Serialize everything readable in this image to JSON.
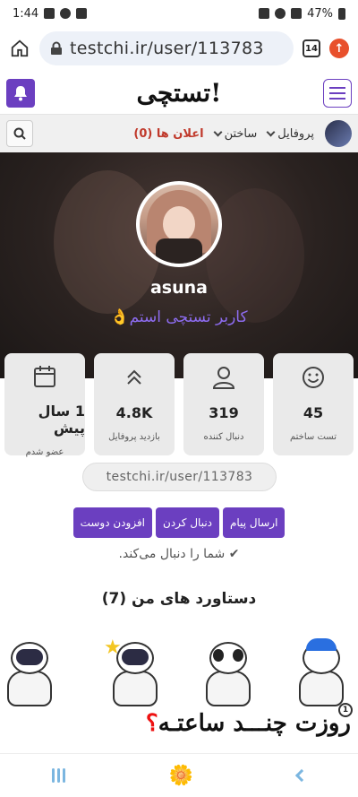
{
  "status_bar": {
    "time": "1:44",
    "battery": "47%"
  },
  "browser": {
    "url": "testchi.ir/user/113783",
    "tab_count": "14"
  },
  "site": {
    "logo": "تستچی!"
  },
  "nav": {
    "profile_label": "پروفایل",
    "build_label": "ساختن",
    "notifications_label": "اعلان ها (0)"
  },
  "profile": {
    "username": "asuna",
    "role": "کاربر تستچی استم👌"
  },
  "stats": [
    {
      "value": "45",
      "label": "تست ساختم",
      "icon": "smiley-icon"
    },
    {
      "value": "319",
      "label": "دنبال کننده",
      "icon": "user-icon"
    },
    {
      "value": "4.8K",
      "label": "بازدید پروفایل",
      "icon": "chevrons-up-icon"
    },
    {
      "value": "1 سال پیش",
      "label": "عضو شدم",
      "icon": "calendar-icon"
    }
  ],
  "profile_url": "testchi.ir/user/113783",
  "actions": {
    "send_message": "ارسال پیام",
    "follow": "دنبال کردن",
    "add_friend": "افزودن دوست"
  },
  "follow_note": "✔ شما را دنبال می‌کند.",
  "achievements": {
    "title": "دستاورد های من (7)"
  },
  "banner": {
    "text": "روزت چنـــد ساعتـه",
    "mark": "؟",
    "badge_count": "1"
  }
}
